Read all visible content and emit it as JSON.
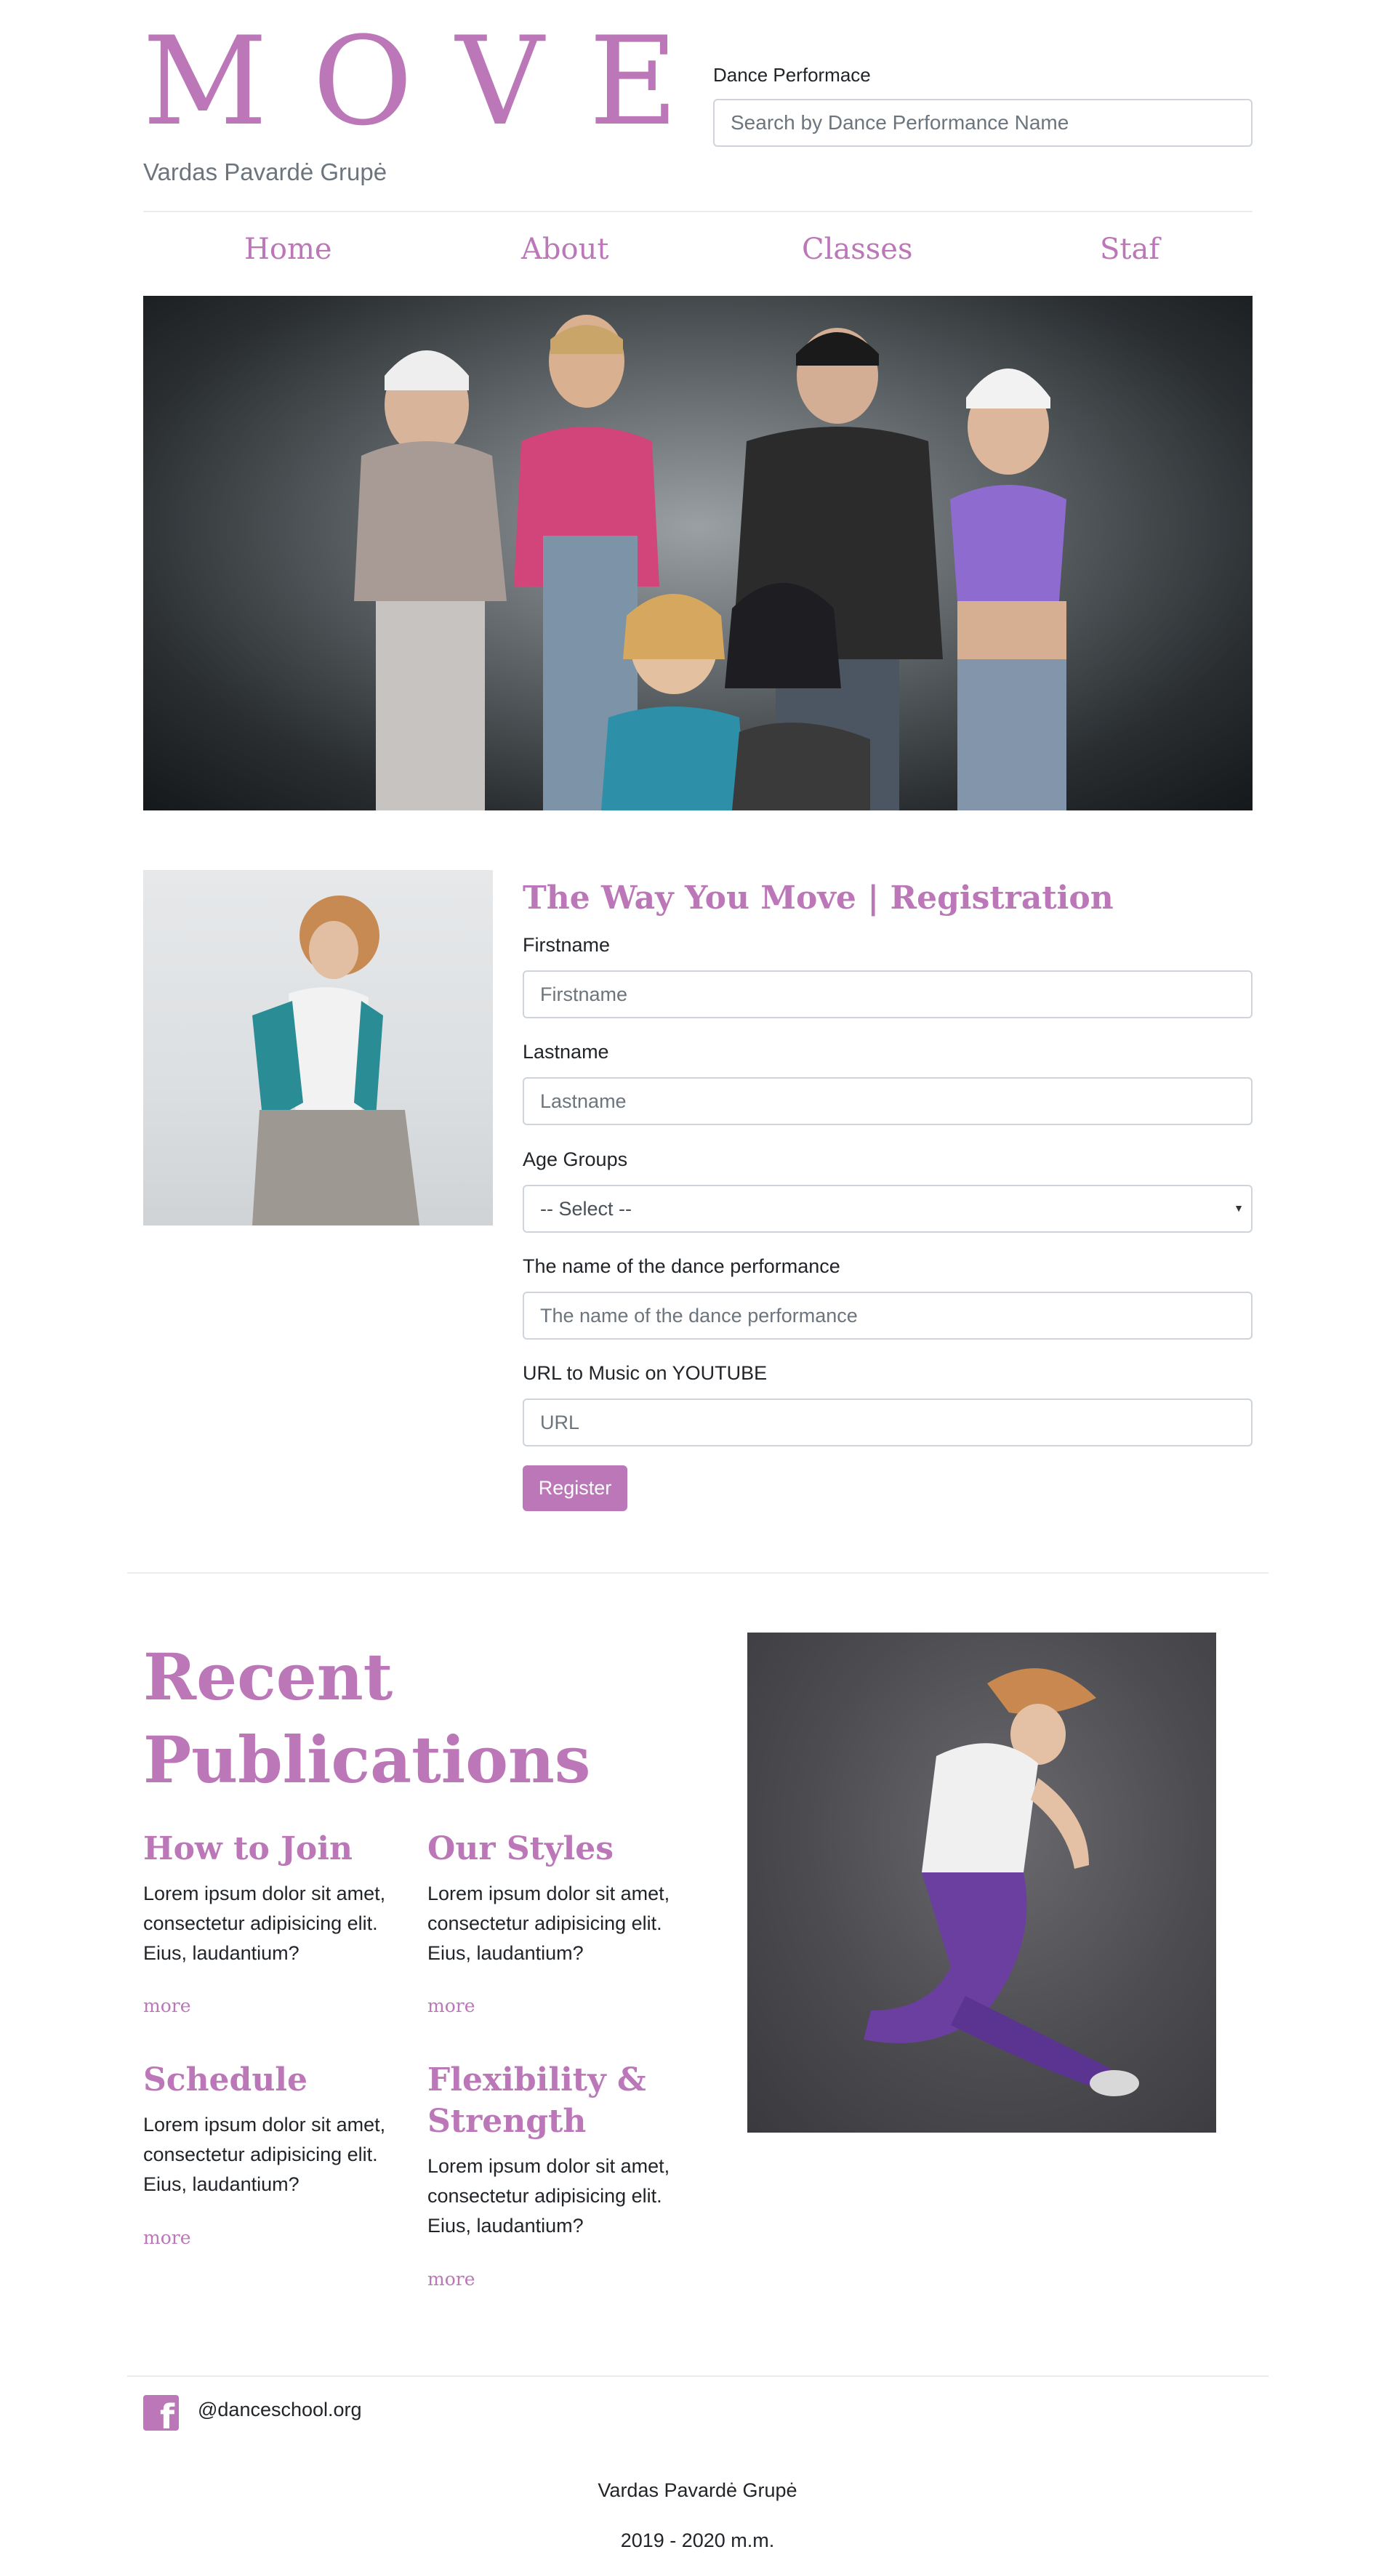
{
  "header": {
    "logo": "MOVE",
    "subtitle": "Vardas Pavardė Grupė",
    "search_label": "Dance Performace",
    "search_placeholder": "Search by Dance Performance Name"
  },
  "nav": {
    "items": [
      {
        "label": "Home"
      },
      {
        "label": "About"
      },
      {
        "label": "Classes"
      },
      {
        "label": "Staf"
      }
    ]
  },
  "registration": {
    "title": "The Way You Move | Registration",
    "fields": [
      {
        "label": "Firstname",
        "placeholder": "Firstname"
      },
      {
        "label": "Lastname",
        "placeholder": "Lastname"
      },
      {
        "label": "Age Groups",
        "selected": "-- Select --"
      },
      {
        "label": "The name of the dance performance",
        "placeholder": "The name of the dance performance"
      },
      {
        "label": "URL to Music on YOUTUBE",
        "placeholder": "URL"
      }
    ],
    "submit_label": "Register"
  },
  "publications": {
    "title": "Recent Publications",
    "items": [
      {
        "heading": "How to Join",
        "text": "Lorem ipsum dolor sit amet, consectetur adipisicing elit. Eius, laudantium?",
        "more": "more"
      },
      {
        "heading": "Our Styles",
        "text": "Lorem ipsum dolor sit amet, consectetur adipisicing elit. Eius, laudantium?",
        "more": "more"
      },
      {
        "heading": "Schedule",
        "text": "Lorem ipsum dolor sit amet, consectetur adipisicing elit. Eius, laudantium?",
        "more": "more"
      },
      {
        "heading": "Flexibility & Strength",
        "text": "Lorem ipsum dolor sit amet, consectetur adipisicing elit. Eius, laudantium?",
        "more": "more"
      }
    ]
  },
  "footer": {
    "social_icon": "facebook-icon",
    "handle": "@danceschool.org",
    "author": "Vardas Pavardė Grupė",
    "years": "2019 - 2020 m.m."
  },
  "colors": {
    "accent": "#bb77b8",
    "text": "#212529",
    "border": "#ced4da"
  }
}
